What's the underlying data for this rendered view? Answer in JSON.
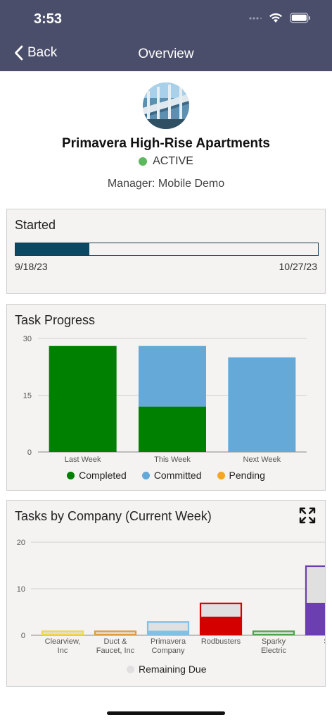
{
  "status_bar": {
    "time": "3:53"
  },
  "nav": {
    "back_label": "Back",
    "title": "Overview"
  },
  "project": {
    "name": "Primavera High-Rise Apartments",
    "status": "ACTIVE",
    "status_color": "#5cb85c",
    "manager": "Manager: Mobile Demo"
  },
  "schedule": {
    "title": "Started",
    "start_date": "9/18/23",
    "end_date": "10/27/23",
    "progress_fraction": 0.245,
    "fill_color": "#0b4863"
  },
  "task_progress": {
    "title": "Task Progress",
    "legend": [
      {
        "label": "Completed",
        "color": "#008000"
      },
      {
        "label": "Committed",
        "color": "#64a9d8"
      },
      {
        "label": "Pending",
        "color": "#f5a623"
      }
    ]
  },
  "tasks_by_company": {
    "title": "Tasks by Company (Current Week)",
    "legend_label": "Remaining Due",
    "legend_color": "#e0e0e0"
  },
  "chart_data": [
    {
      "type": "bar",
      "title": "Task Progress",
      "categories": [
        "Last Week",
        "This Week",
        "Next Week"
      ],
      "series": [
        {
          "name": "Completed",
          "values": [
            28,
            12,
            0
          ],
          "color": "#008000"
        },
        {
          "name": "Committed",
          "values": [
            0,
            16,
            25
          ],
          "color": "#64a9d8"
        },
        {
          "name": "Pending",
          "values": [
            0,
            0,
            0
          ],
          "color": "#f5a623"
        }
      ],
      "yticks": [
        "0",
        "15",
        "30"
      ],
      "ylim": [
        0,
        30
      ],
      "stacked": true,
      "grid": true
    },
    {
      "type": "bar",
      "title": "Tasks by Company (Current Week)",
      "categories": [
        [
          "Clearview,",
          "Inc"
        ],
        [
          "Duct &",
          "Faucet, Inc"
        ],
        [
          "Primavera",
          "Company"
        ],
        [
          "Rodbusters"
        ],
        [
          "Sparky",
          "Electric"
        ],
        [
          "S"
        ]
      ],
      "colors": [
        "#f0d84a",
        "#e39a3e",
        "#7fc1e8",
        "#d40000",
        "#4ea34a",
        "#6b3fb0"
      ],
      "completed": [
        0,
        0,
        1,
        4,
        0,
        7
      ],
      "totals": [
        1,
        1,
        3,
        7,
        1,
        15
      ],
      "series": [
        {
          "name": "Remaining Due",
          "values": [
            1,
            1,
            2,
            3,
            1,
            8
          ],
          "color": "#e0e0e0"
        }
      ],
      "yticks": [
        "0",
        "10",
        "20"
      ],
      "ylim": [
        0,
        20
      ],
      "grid": true
    }
  ]
}
